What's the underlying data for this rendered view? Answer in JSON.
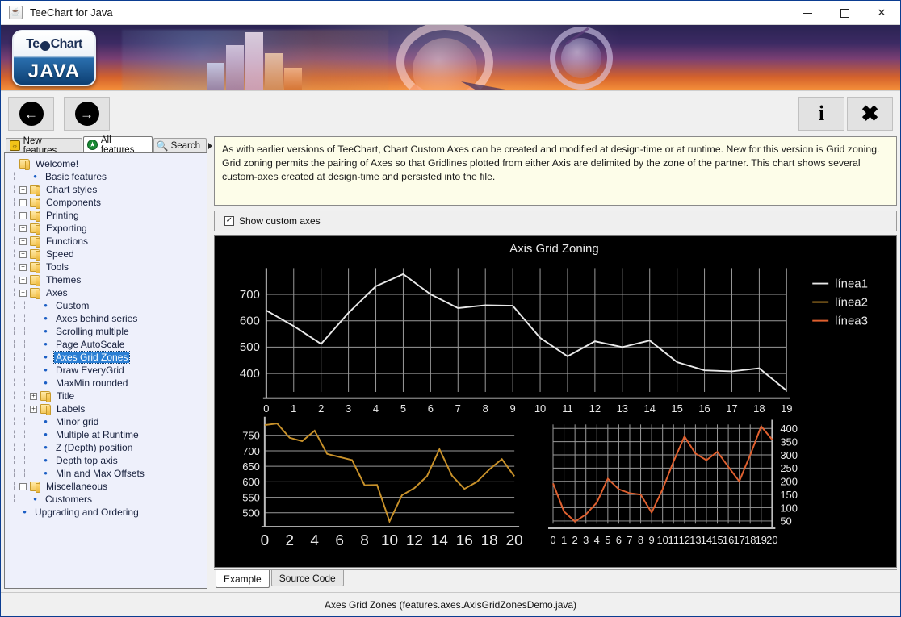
{
  "window": {
    "title": "TeeChart for Java",
    "app_icon": "java-coffee-icon",
    "minimize": "–",
    "maximize": "□",
    "close": "✕"
  },
  "banner": {
    "logo_line1_left": "Te",
    "logo_line1_right": "Chart",
    "logo_line2": "JAVA"
  },
  "toolbar": {
    "back": "←",
    "forward": "→",
    "info": "i",
    "close": "✖"
  },
  "sidebar": {
    "tabs": [
      {
        "label": "New features",
        "icon": "lightbulb-icon",
        "active": false
      },
      {
        "label": "All features",
        "icon": "green-star-icon",
        "active": true
      },
      {
        "label": "Search",
        "icon": "magnifier-icon",
        "active": false
      }
    ],
    "tree": [
      {
        "label": "Welcome!",
        "depth": 0,
        "kind": "folder",
        "toggle": "none",
        "selected": false
      },
      {
        "label": "Basic features",
        "depth": 1,
        "kind": "leaf",
        "toggle": "none",
        "selected": false
      },
      {
        "label": "Chart styles",
        "depth": 1,
        "kind": "folder",
        "toggle": "plus",
        "selected": false
      },
      {
        "label": "Components",
        "depth": 1,
        "kind": "folder",
        "toggle": "plus",
        "selected": false
      },
      {
        "label": "Printing",
        "depth": 1,
        "kind": "folder",
        "toggle": "plus",
        "selected": false
      },
      {
        "label": "Exporting",
        "depth": 1,
        "kind": "folder",
        "toggle": "plus",
        "selected": false
      },
      {
        "label": "Functions",
        "depth": 1,
        "kind": "folder",
        "toggle": "plus",
        "selected": false
      },
      {
        "label": "Speed",
        "depth": 1,
        "kind": "folder",
        "toggle": "plus",
        "selected": false
      },
      {
        "label": "Tools",
        "depth": 1,
        "kind": "folder",
        "toggle": "plus",
        "selected": false
      },
      {
        "label": "Themes",
        "depth": 1,
        "kind": "folder",
        "toggle": "plus",
        "selected": false
      },
      {
        "label": "Axes",
        "depth": 1,
        "kind": "folder",
        "toggle": "minus",
        "selected": false
      },
      {
        "label": "Custom",
        "depth": 2,
        "kind": "leaf",
        "toggle": "none",
        "selected": false
      },
      {
        "label": "Axes behind series",
        "depth": 2,
        "kind": "leaf",
        "toggle": "none",
        "selected": false
      },
      {
        "label": "Scrolling multiple",
        "depth": 2,
        "kind": "leaf",
        "toggle": "none",
        "selected": false
      },
      {
        "label": "Page AutoScale",
        "depth": 2,
        "kind": "leaf",
        "toggle": "none",
        "selected": false
      },
      {
        "label": "Axes Grid Zones",
        "depth": 2,
        "kind": "leaf",
        "toggle": "none",
        "selected": true
      },
      {
        "label": "Draw EveryGrid",
        "depth": 2,
        "kind": "leaf",
        "toggle": "none",
        "selected": false
      },
      {
        "label": "MaxMin rounded",
        "depth": 2,
        "kind": "leaf",
        "toggle": "none",
        "selected": false
      },
      {
        "label": "Title",
        "depth": 2,
        "kind": "folder",
        "toggle": "plus",
        "selected": false
      },
      {
        "label": "Labels",
        "depth": 2,
        "kind": "folder",
        "toggle": "plus",
        "selected": false
      },
      {
        "label": "Minor grid",
        "depth": 2,
        "kind": "leaf",
        "toggle": "none",
        "selected": false
      },
      {
        "label": "Multiple at Runtime",
        "depth": 2,
        "kind": "leaf",
        "toggle": "none",
        "selected": false
      },
      {
        "label": "Z (Depth) position",
        "depth": 2,
        "kind": "leaf",
        "toggle": "none",
        "selected": false
      },
      {
        "label": "Depth top axis",
        "depth": 2,
        "kind": "leaf",
        "toggle": "none",
        "selected": false
      },
      {
        "label": "Min and Max Offsets",
        "depth": 2,
        "kind": "leaf",
        "toggle": "none",
        "selected": false
      },
      {
        "label": "Miscellaneous",
        "depth": 1,
        "kind": "folder",
        "toggle": "plus",
        "selected": false
      },
      {
        "label": "Customers",
        "depth": 1,
        "kind": "leaf",
        "toggle": "none",
        "selected": false
      },
      {
        "label": "Upgrading and Ordering",
        "depth": 0,
        "kind": "leaf",
        "toggle": "none",
        "selected": false
      }
    ]
  },
  "description": "As with earlier versions of TeeChart, Chart Custom Axes can be created and modified at design-time or at runtime. New for this version is Grid zoning. Grid zoning permits the pairing of Axes so that Gridlines plotted from either Axis are delimited by the zone of the partner. This chart shows several custom-axes created at design-time and persisted into the file.",
  "options": {
    "show_custom_axes_label": "Show custom axes",
    "show_custom_axes_checked": true,
    "check_glyph": "✓"
  },
  "bottom_tabs": [
    {
      "label": "Example",
      "active": true
    },
    {
      "label": "Source Code",
      "active": false
    }
  ],
  "status": {
    "text": "Axes Grid Zones  (features.axes.AxisGridZonesDemo.java)"
  },
  "colors": {
    "chart_background": "#000000",
    "grid": "#9a9a9a",
    "linea1": "#e8e8e8",
    "linea2": "#c8912a",
    "linea3": "#e0602f",
    "selection": "#2b7fd4",
    "description_background": "#fdfde9"
  },
  "chart_data": [
    {
      "type": "line",
      "id": "main-axis-grid-zoning",
      "title": "Axis Grid Zoning",
      "xlabel": "",
      "ylabel": "",
      "grid": true,
      "legend_position": "right",
      "legend": [
        "línea1",
        "línea2",
        "línea3"
      ],
      "xlim": [
        0,
        19
      ],
      "ylim": [
        330,
        800
      ],
      "xticks": [
        0,
        1,
        2,
        3,
        4,
        5,
        6,
        7,
        8,
        9,
        10,
        11,
        12,
        13,
        14,
        15,
        16,
        17,
        18,
        19
      ],
      "yticks": [
        400,
        500,
        600,
        700
      ],
      "series": [
        {
          "name": "línea1",
          "color": "#e8e8e8",
          "x": [
            0,
            1,
            2,
            3,
            4,
            5,
            6,
            7,
            8,
            9,
            10,
            11,
            12,
            13,
            14,
            15,
            16,
            17,
            18,
            19
          ],
          "values": [
            639,
            580,
            512,
            630,
            731,
            777,
            700,
            648,
            659,
            657,
            535,
            465,
            522,
            500,
            525,
            443,
            412,
            408,
            420,
            335
          ]
        }
      ]
    },
    {
      "type": "line",
      "id": "bottom-left-custom-axis",
      "title": "",
      "grid": true,
      "xlim": [
        0,
        20
      ],
      "ylim": [
        470,
        790
      ],
      "xticks": [
        0,
        2,
        4,
        6,
        8,
        10,
        12,
        14,
        16,
        18,
        20
      ],
      "yticks": [
        500,
        550,
        600,
        650,
        700,
        750
      ],
      "series": [
        {
          "name": "línea2",
          "color": "#c8912a",
          "x": [
            0,
            1,
            2,
            3,
            4,
            5,
            6,
            7,
            8,
            9,
            10,
            11,
            12,
            13,
            14,
            15,
            16,
            17,
            18,
            19,
            20
          ],
          "values": [
            783,
            788,
            742,
            731,
            765,
            690,
            680,
            670,
            589,
            590,
            472,
            557,
            580,
            618,
            705,
            620,
            577,
            600,
            640,
            673,
            618
          ]
        }
      ]
    },
    {
      "type": "line",
      "id": "bottom-right-custom-axis",
      "title": "",
      "grid": true,
      "xlim": [
        0,
        20
      ],
      "ylim": [
        40,
        415
      ],
      "xticks": [
        0,
        1,
        2,
        3,
        4,
        5,
        6,
        7,
        8,
        9,
        10,
        11,
        12,
        13,
        14,
        15,
        16,
        17,
        18,
        19,
        20
      ],
      "yticks": [
        50,
        100,
        150,
        200,
        250,
        300,
        350,
        400
      ],
      "yaxis_position": "right",
      "series": [
        {
          "name": "línea3",
          "color": "#e0602f",
          "x": [
            0,
            1,
            2,
            3,
            4,
            5,
            6,
            7,
            8,
            9,
            10,
            11,
            12,
            13,
            14,
            15,
            16,
            17,
            18,
            19,
            20
          ],
          "values": [
            192,
            86,
            48,
            75,
            120,
            210,
            170,
            155,
            150,
            82,
            170,
            275,
            370,
            305,
            280,
            312,
            255,
            200,
            300,
            408,
            358
          ]
        }
      ]
    }
  ]
}
